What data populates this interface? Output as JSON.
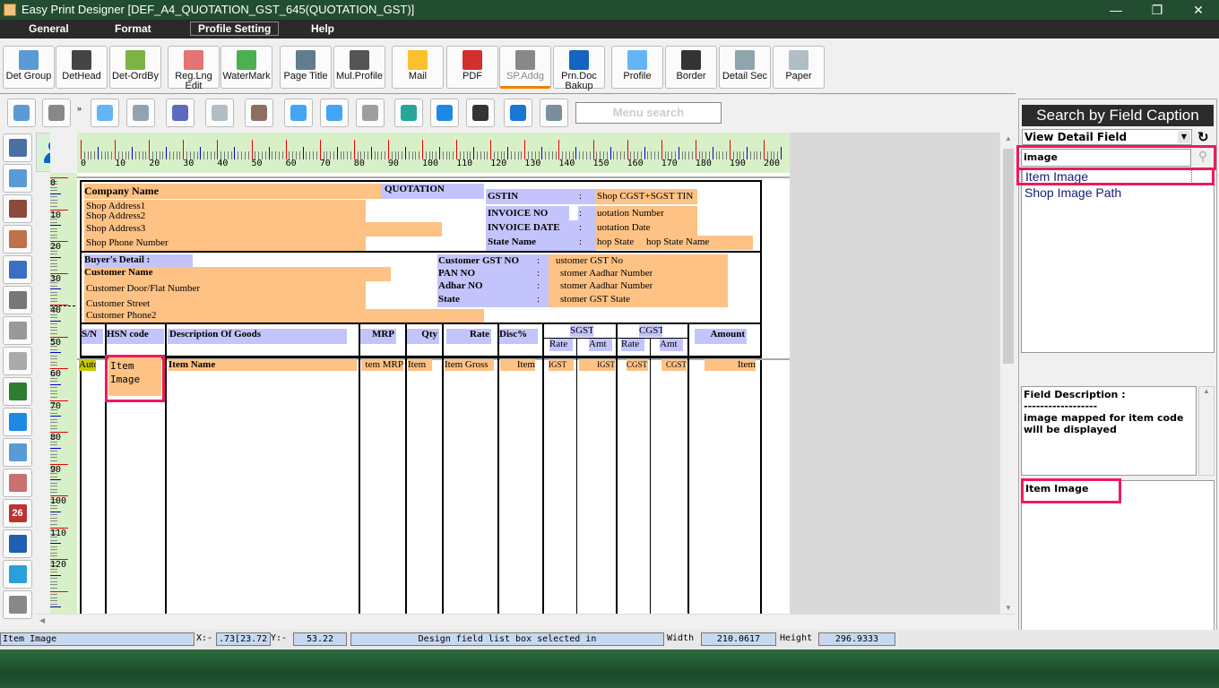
{
  "window": {
    "title": "Easy Print Designer [DEF_A4_QUOTATION_GST_645(QUOTATION_GST)]",
    "minimize": "—",
    "maximize": "❐",
    "close": "✕"
  },
  "menu": [
    "General",
    "Format",
    "Profile Setting",
    "Help"
  ],
  "toolbar1": [
    {
      "label": "Det Group",
      "color": "#5b9bd5"
    },
    {
      "label": "DetHead",
      "color": "#444"
    },
    {
      "label": "Det-OrdBy",
      "color": "#7cb342"
    },
    {
      "label": "Reg.Lng Edit",
      "color": "#e57373"
    },
    {
      "label": "WaterMark",
      "color": "#4caf50"
    },
    {
      "label": "Page Title",
      "color": "#607d8b"
    },
    {
      "label": "Mul.Profile",
      "color": "#555"
    },
    {
      "label": "Mail",
      "color": "#fbc02d"
    },
    {
      "label": "PDF",
      "color": "#d32f2f"
    },
    {
      "label": "SP.Addg",
      "color": "#888"
    },
    {
      "label": "Prn.Doc Bakup",
      "color": "#1565c0"
    },
    {
      "label": "Profile",
      "color": "#64b5f6"
    },
    {
      "label": "Border",
      "color": "#333"
    },
    {
      "label": "Detail Sec",
      "color": "#90a4ae"
    },
    {
      "label": "Paper",
      "color": "#b0bec5"
    }
  ],
  "toolbar2_icons": [
    "preview-icon",
    "print-icon",
    "field-edit-icon",
    "field-delete-icon",
    "printer-settings-icon",
    "page-settings-icon",
    "download-field-icon",
    "cloud-upload-icon",
    "cloud-download-icon",
    "receipt-printer-icon",
    "network-printer-icon",
    "globe-icon",
    "cash-drawer-icon",
    "printer-add-icon",
    "printer-icon"
  ],
  "menu_search_placeholder": "Menu search",
  "left_tools": [
    "text-field-icon",
    "layout-icon",
    "line-icon",
    "pencil-icon",
    "dots-icon",
    "rectangle-icon",
    "column-edit-icon",
    "note-edit-icon",
    "image-add-icon",
    "numbered-list-icon",
    "table-icon",
    "clock-icon",
    "calendar-icon",
    "page-number-icon",
    "percent-icon",
    "coins-icon"
  ],
  "calendar_day": "26",
  "ruler": {
    "top": [
      "0",
      "10",
      "20",
      "30",
      "40",
      "50",
      "60",
      "70",
      "80",
      "90",
      "100",
      "110",
      "120",
      "130",
      "140",
      "150",
      "160",
      "170",
      "180",
      "190",
      "200"
    ],
    "left": [
      "0",
      "10",
      "20",
      "30",
      "40",
      "50",
      "60",
      "70",
      "80",
      "90",
      "100",
      "110",
      "120"
    ]
  },
  "doc": {
    "company_name": "Company Name",
    "quotation": "QUOTATION",
    "addr1": "Shop Address1",
    "addr2": "Shop Address2",
    "addr3": "Shop Address3",
    "phone": "Shop Phone Number",
    "gstin": "GSTIN",
    "invoice_no": "INVOICE NO",
    "invoice_date": "INVOICE DATE",
    "state_name": "State Name",
    "colon": ":",
    "gstin_val": "Shop CGST+SGST TIN",
    "inv_no_val": "uotation Number",
    "inv_date_val": "uotation Date",
    "state_val1": "hop State",
    "state_val2": "hop State Name",
    "buyer": "Buyer's Detail :",
    "cust_name": "Customer Name",
    "cust_door": "Customer Door/Flat Number",
    "cust_street": "Customer Street",
    "cust_phone": "Customer Phone2",
    "cust_gst": "Customer GST NO",
    "pan": "PAN NO",
    "adhar": "Adhar NO",
    "state": "State",
    "cust_gst_val": "ustomer GST No",
    "pan_val": "stomer Aadhar Number",
    "adhar_val": "stomer Aadhar Number",
    "state_val": "stomer GST State",
    "headers": {
      "sn": "S/N",
      "hsn": "HSN code",
      "desc": "Description Of Goods",
      "mrp": "MRP",
      "qty": "Qty",
      "rate": "Rate",
      "disc": "Disc%",
      "sgst": "SGST",
      "cgst": "CGST",
      "sub_rate": "Rate",
      "sub_amt": "Amt",
      "amount": "Amount"
    },
    "row": {
      "auto": "Auto",
      "item_image": "Item Image",
      "item_name": "Item Name",
      "mrp": "tem MRP",
      "qty": "Item",
      "rate": "Item Gross",
      "disc": "Item",
      "igst1": "IGST",
      "igst2": "IGST",
      "cgst1": "CGST",
      "cgst2": "CGST",
      "amount": "Item"
    }
  },
  "right_panel": {
    "title": "Search by Field Caption",
    "view_select": "View Detail Field",
    "search_value": "image",
    "results": [
      "Item Image",
      "Shop Image Path"
    ],
    "desc_label": "Field Description :",
    "desc_sep": "------------------",
    "desc_text": "image mapped for item code will be displayed",
    "selected_field": "Item Image"
  },
  "status": {
    "field": "Item Image",
    "x_label": "X:-",
    "x_val": ".73[23.72",
    "y_label": "Y:-",
    "y_val": "53.22",
    "message": "Design field list box selected in",
    "width_label": "Width",
    "width_val": "210.0617",
    "height_label": "Height",
    "height_val": "296.9333"
  }
}
